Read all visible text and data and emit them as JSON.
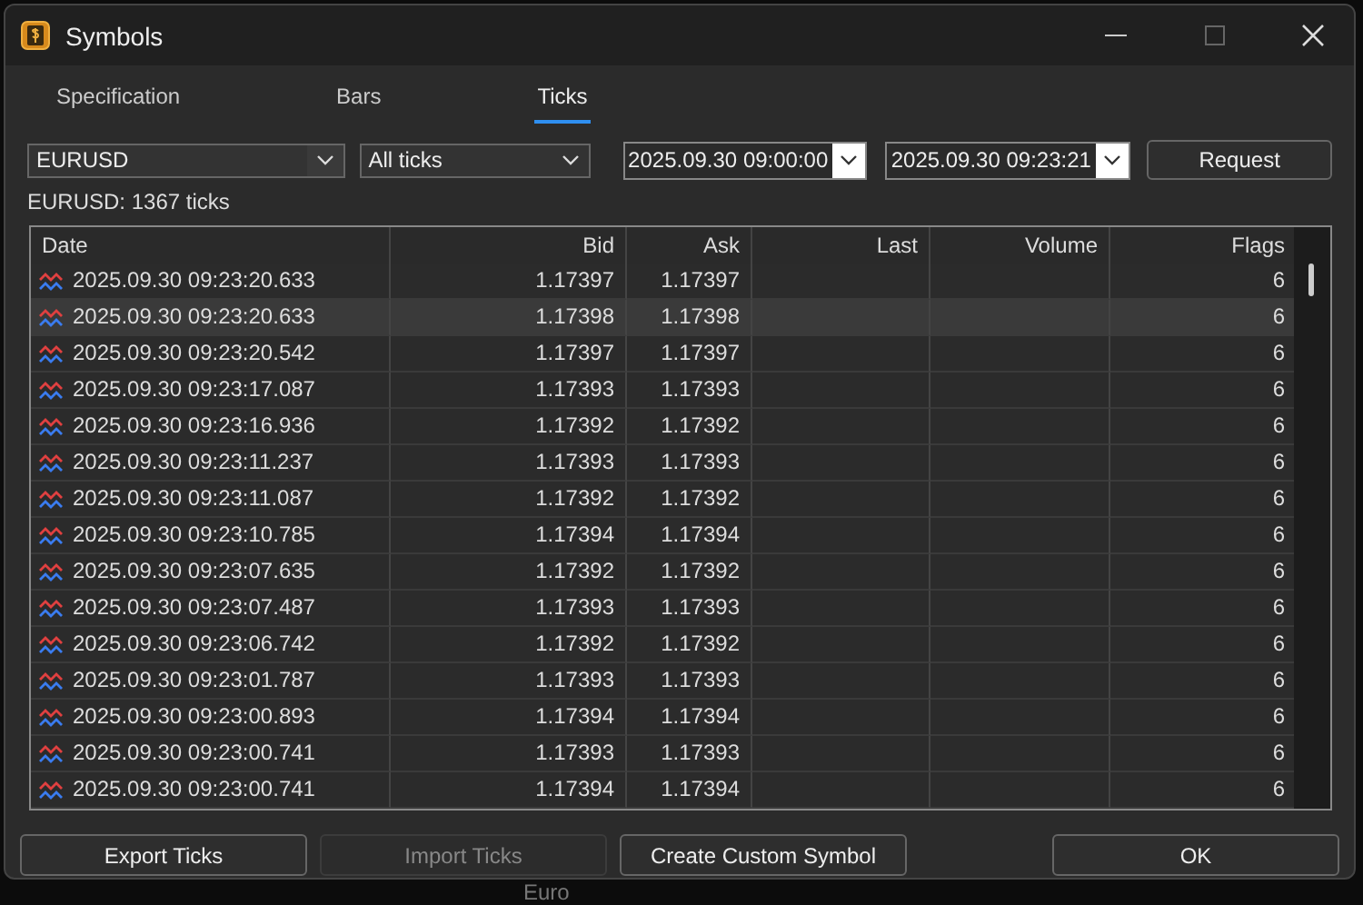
{
  "window": {
    "title": "Symbols"
  },
  "background": {
    "label": "Euro"
  },
  "tabs": [
    {
      "label": "Specification",
      "selected": false
    },
    {
      "label": "Bars",
      "selected": false
    },
    {
      "label": "Ticks",
      "selected": true
    }
  ],
  "filters": {
    "symbol": "EURUSD",
    "tick_type": "All ticks",
    "from": "2025.09.30 09:00:00",
    "to": "2025.09.30 09:23:21",
    "request_button": "Request"
  },
  "summary": "EURUSD: 1367 ticks",
  "table": {
    "columns": [
      "Date",
      "Bid",
      "Ask",
      "Last",
      "Volume",
      "Flags"
    ],
    "rows": [
      {
        "date": "2025.09.30 09:23:20.633",
        "bid": "1.17397",
        "ask": "1.17397",
        "flags": "6",
        "selected": false
      },
      {
        "date": "2025.09.30 09:23:20.633",
        "bid": "1.17398",
        "ask": "1.17398",
        "flags": "6",
        "selected": true
      },
      {
        "date": "2025.09.30 09:23:20.542",
        "bid": "1.17397",
        "ask": "1.17397",
        "flags": "6",
        "selected": false
      },
      {
        "date": "2025.09.30 09:23:17.087",
        "bid": "1.17393",
        "ask": "1.17393",
        "flags": "6",
        "selected": false
      },
      {
        "date": "2025.09.30 09:23:16.936",
        "bid": "1.17392",
        "ask": "1.17392",
        "flags": "6",
        "selected": false
      },
      {
        "date": "2025.09.30 09:23:11.237",
        "bid": "1.17393",
        "ask": "1.17393",
        "flags": "6",
        "selected": false
      },
      {
        "date": "2025.09.30 09:23:11.087",
        "bid": "1.17392",
        "ask": "1.17392",
        "flags": "6",
        "selected": false
      },
      {
        "date": "2025.09.30 09:23:10.785",
        "bid": "1.17394",
        "ask": "1.17394",
        "flags": "6",
        "selected": false
      },
      {
        "date": "2025.09.30 09:23:07.635",
        "bid": "1.17392",
        "ask": "1.17392",
        "flags": "6",
        "selected": false
      },
      {
        "date": "2025.09.30 09:23:07.487",
        "bid": "1.17393",
        "ask": "1.17393",
        "flags": "6",
        "selected": false
      },
      {
        "date": "2025.09.30 09:23:06.742",
        "bid": "1.17392",
        "ask": "1.17392",
        "flags": "6",
        "selected": false
      },
      {
        "date": "2025.09.30 09:23:01.787",
        "bid": "1.17393",
        "ask": "1.17393",
        "flags": "6",
        "selected": false
      },
      {
        "date": "2025.09.30 09:23:00.893",
        "bid": "1.17394",
        "ask": "1.17394",
        "flags": "6",
        "selected": false
      },
      {
        "date": "2025.09.30 09:23:00.741",
        "bid": "1.17393",
        "ask": "1.17393",
        "flags": "6",
        "selected": false
      },
      {
        "date": "2025.09.30 09:23:00.741",
        "bid": "1.17394",
        "ask": "1.17394",
        "flags": "6",
        "selected": false
      }
    ]
  },
  "buttons": [
    {
      "label": "Export Ticks",
      "disabled": false
    },
    {
      "label": "Import Ticks",
      "disabled": true
    },
    {
      "label": "Create Custom Symbol",
      "disabled": false
    }
  ],
  "ok_button": "OK"
}
